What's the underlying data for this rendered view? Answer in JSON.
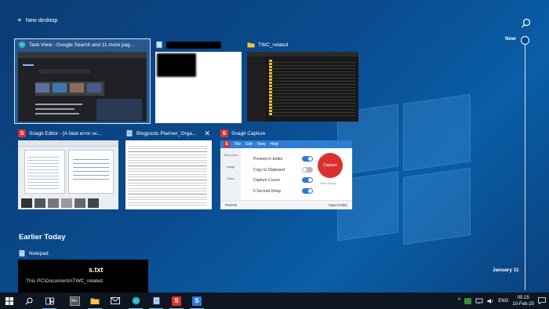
{
  "topbar": {
    "new_desktop_label": "New desktop",
    "search_icon": "search-icon"
  },
  "timeline": {
    "now_label": "Now",
    "date_label": "January 11"
  },
  "windows": [
    {
      "title": "Task View - Google Search and 11 more pag...",
      "icon": "edge-icon"
    },
    {
      "title": "",
      "icon": "document-icon"
    },
    {
      "title": "TWC_related",
      "icon": "folder-icon"
    },
    {
      "title": "Snagit Editor - [A fatal error oc...",
      "icon": "snagit-icon"
    },
    {
      "title": "Blogposts Planner_Orga...",
      "icon": "notepad-icon"
    },
    {
      "title": "Snagit Capture",
      "icon": "snagit-icon"
    }
  ],
  "snagit_capture": {
    "menu": [
      "File",
      "Edit",
      "View",
      "Help"
    ],
    "tabs": [
      "All-in-One",
      "Image",
      "Video"
    ],
    "options": [
      {
        "label": "Preview in Editor",
        "on": true
      },
      {
        "label": "Copy to Clipboard",
        "on": false
      },
      {
        "label": "Capture Cursor",
        "on": true
      },
      {
        "label": "5 Second Delay",
        "on": true
      }
    ],
    "capture_button": "Capture",
    "hotkey_label": "Add Hotkey",
    "presets_label": "Presets",
    "open_editor_label": "Open Editor"
  },
  "earlier_today": {
    "section_title": "Earlier Today",
    "item_title": "Notepad",
    "item_filename": "s.txt",
    "item_path": "This PC\\Documents\\TWC_related"
  },
  "taskbar": {
    "tray_language": "ENG",
    "time": "05:15",
    "date": "10-Feb-20"
  },
  "colors": {
    "accent": "#0b4a8a",
    "snagit_red": "#d9322e",
    "toggle_blue": "#2f7bd8"
  }
}
